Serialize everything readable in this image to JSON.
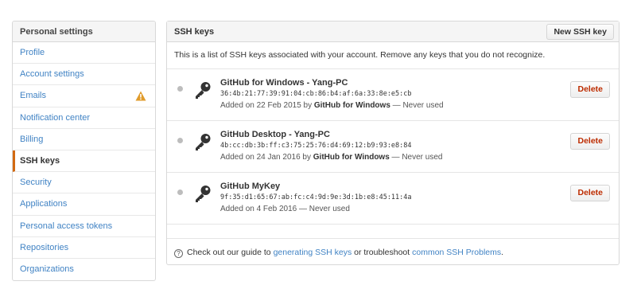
{
  "sidebar": {
    "header": "Personal settings",
    "items": [
      {
        "label": "Profile"
      },
      {
        "label": "Account settings"
      },
      {
        "label": "Emails"
      },
      {
        "label": "Notification center"
      },
      {
        "label": "Billing"
      },
      {
        "label": "SSH keys"
      },
      {
        "label": "Security"
      },
      {
        "label": "Applications"
      },
      {
        "label": "Personal access tokens"
      },
      {
        "label": "Repositories"
      },
      {
        "label": "Organizations"
      }
    ],
    "selected": "SSH keys",
    "warning_icon": "warning-triangle-icon"
  },
  "panel": {
    "title": "SSH keys",
    "new_key_label": "New SSH key",
    "intro": "This is a list of SSH keys associated with your account. Remove any keys that you do not recognize.",
    "keys": [
      {
        "title": "GitHub for Windows - Yang-PC",
        "fingerprint": "36:4b:21:77:39:91:04:cb:86:b4:af:6a:33:8e:e5:cb",
        "added_prefix": "Added on 22 Feb 2015 by ",
        "added_by": "GitHub for Windows",
        "added_suffix": " — Never used",
        "delete_label": "Delete"
      },
      {
        "title": "GitHub Desktop - Yang-PC",
        "fingerprint": "4b:cc:db:3b:ff:c3:75:25:76:d4:69:12:b9:93:e8:84",
        "added_prefix": "Added on 24 Jan 2016 by ",
        "added_by": "GitHub for Windows",
        "added_suffix": " — Never used",
        "delete_label": "Delete"
      },
      {
        "title": "GitHub MyKey",
        "fingerprint": "9f:35:d1:65:67:ab:fc:c4:9d:9e:3d:1b:e8:45:11:4a",
        "added_prefix": "Added on 4 Feb 2016 — Never used",
        "added_by": "",
        "added_suffix": "",
        "delete_label": "Delete"
      }
    ],
    "footer": {
      "help_glyph": "?",
      "prefix": "Check out our guide to ",
      "link1": "generating SSH keys",
      "middle": " or troubleshoot ",
      "link2": "common SSH Problems",
      "suffix": "."
    }
  },
  "colors": {
    "link": "#4183c4",
    "accent": "#d26911",
    "delete": "#bd2c00",
    "warning": "#e09b2b"
  }
}
